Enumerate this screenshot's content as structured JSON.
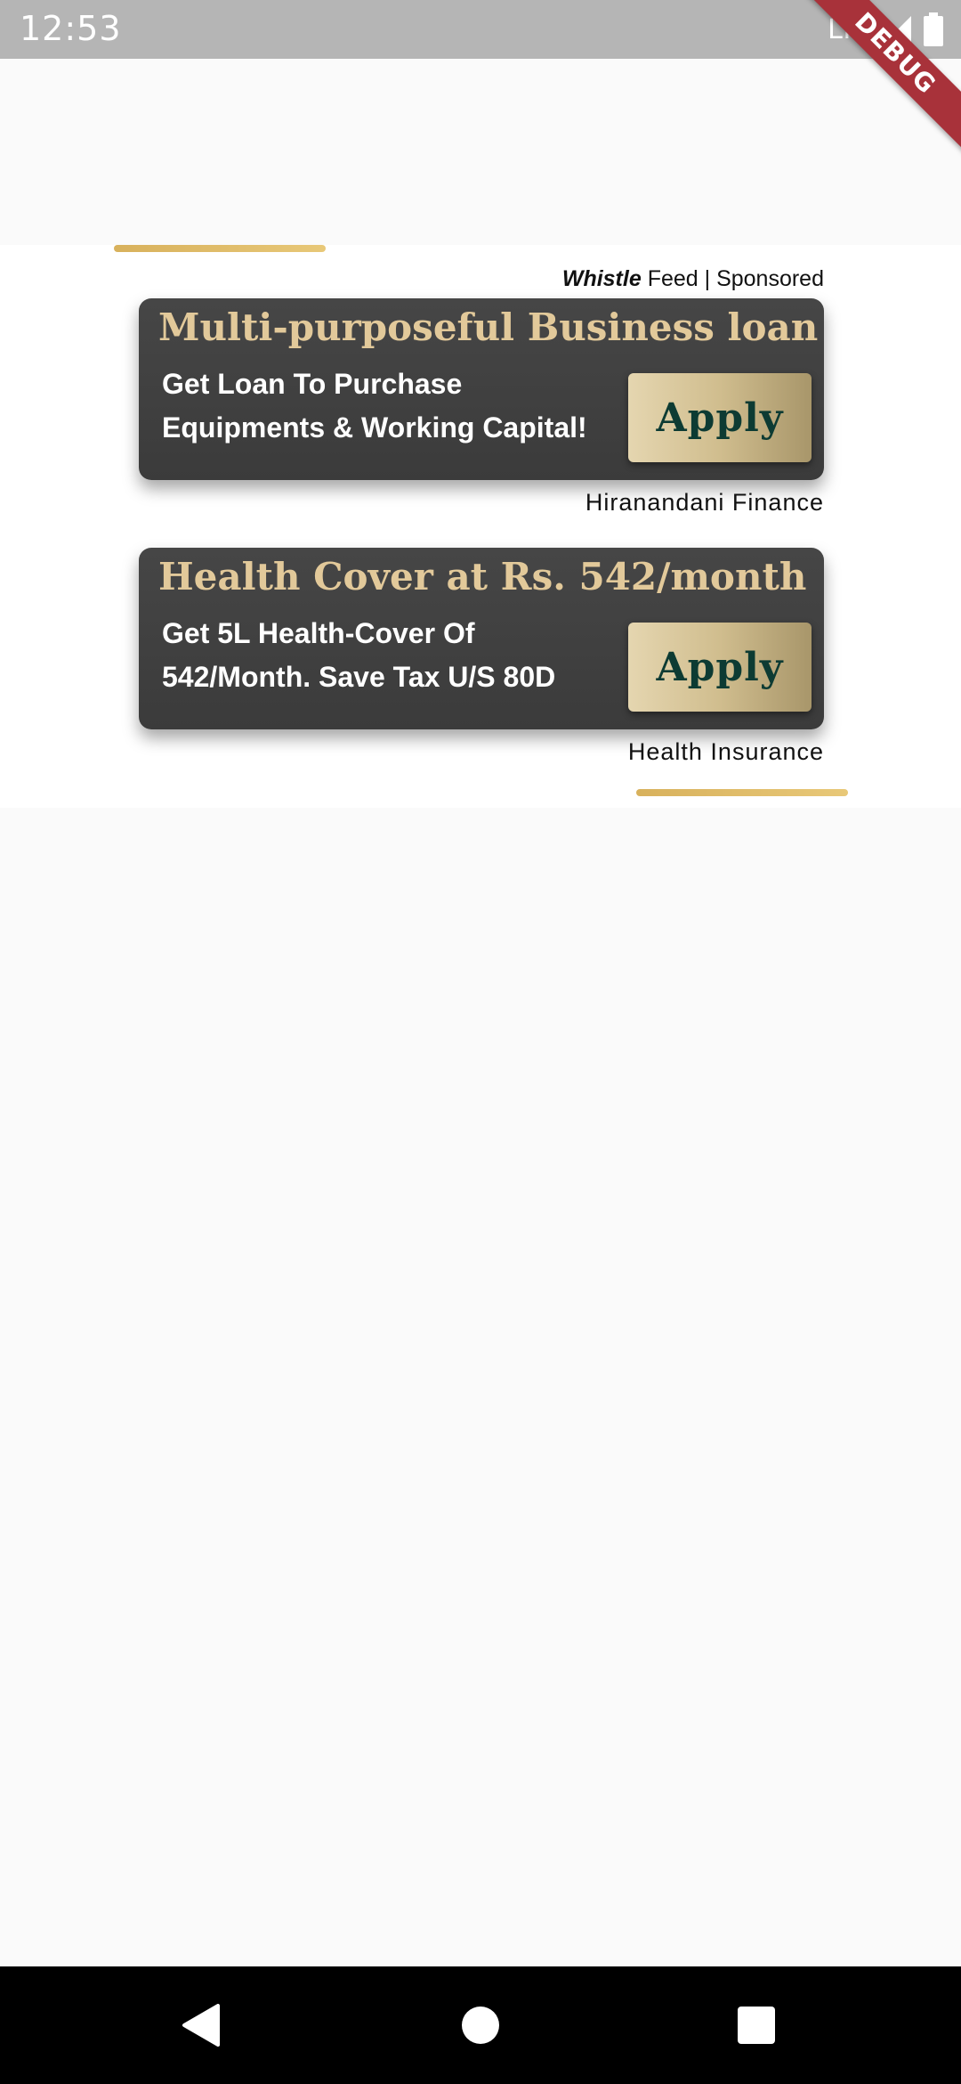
{
  "status_bar": {
    "time": "12:53",
    "network": "LTE",
    "debug_label": "DEBUG"
  },
  "feed": {
    "brand": "Whistle",
    "sponsored_rest": " Feed | Sponsored",
    "accent_color": "#d8b15c",
    "ads": [
      {
        "title": "Multi-purposeful Business loan",
        "line1": "Get Loan To Purchase",
        "line2": "Equipments & Working Capital!",
        "button": "Apply",
        "source": "Hiranandani Finance"
      },
      {
        "title": "Health Cover at Rs. 542/month",
        "line1": "Get 5L Health-Cover Of",
        "line2": "542/Month. Save Tax U/S 80D",
        "button": "Apply",
        "source": "Health Insurance"
      }
    ]
  },
  "nav": {
    "back_icon": "triangle-back",
    "home_icon": "circle-home",
    "recent_icon": "square-recents"
  }
}
